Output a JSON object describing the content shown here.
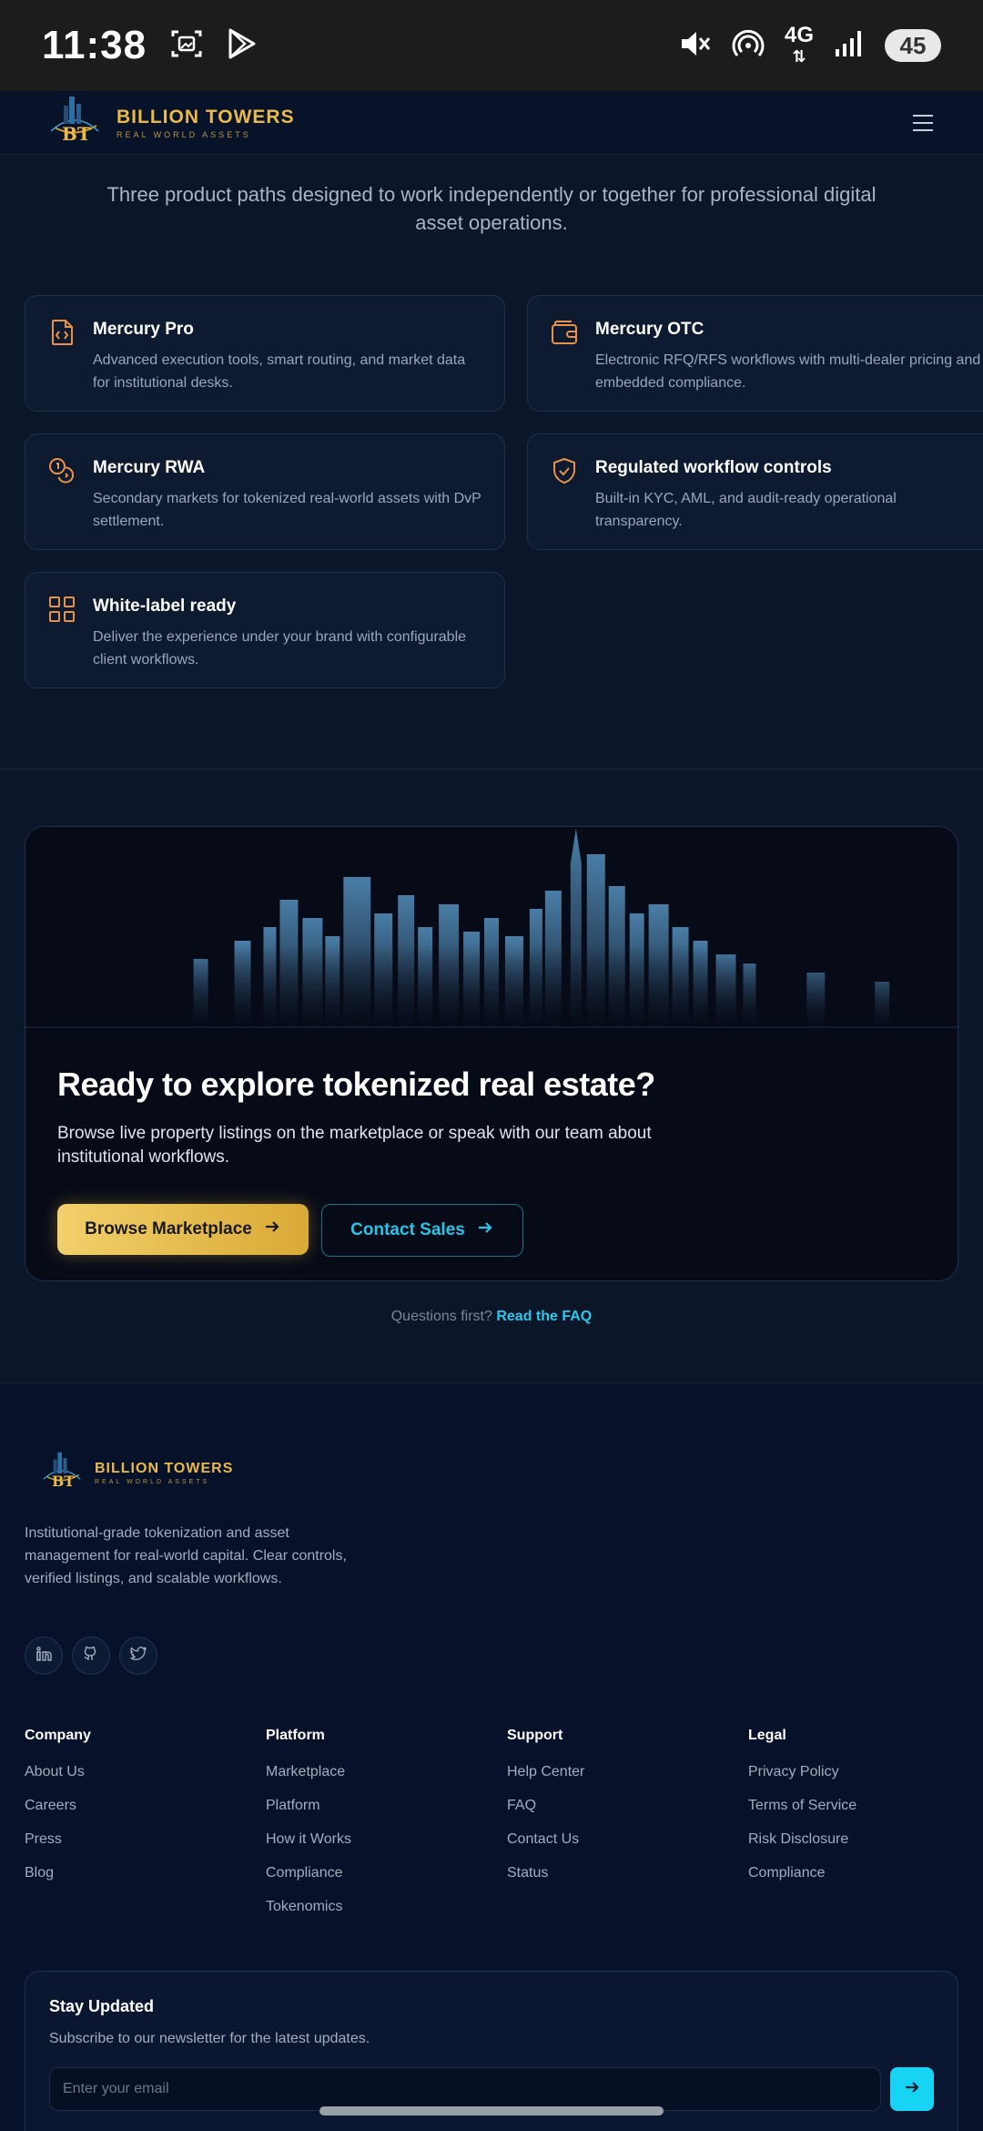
{
  "status_bar": {
    "time": "11:38",
    "network": "4G",
    "battery": "45"
  },
  "nav": {
    "brand_name": "BILLION TOWERS",
    "brand_tagline": "REAL WORLD ASSETS",
    "logo_mark": "BT"
  },
  "products": {
    "subtitle": "Three product paths designed to work independently or together for professional digital asset operations.",
    "cards": [
      {
        "title": "Mercury Pro",
        "description": "Advanced execution tools, smart routing, and market data for institutional desks.",
        "icon": "code-file-icon"
      },
      {
        "title": "Mercury OTC",
        "description": "Electronic RFQ/RFS workflows with multi-dealer pricing and embedded compliance.",
        "icon": "wallet-icon"
      },
      {
        "title": "Mercury RWA",
        "description": "Secondary markets for tokenized real-world assets with DvP settlement.",
        "icon": "coins-icon"
      },
      {
        "title": "Regulated workflow controls",
        "description": "Built-in KYC, AML, and audit-ready operational transparency.",
        "icon": "shield-check-icon"
      },
      {
        "title": "White-label ready",
        "description": "Deliver the experience under your brand with configurable client workflows.",
        "icon": "grid-icon"
      }
    ]
  },
  "cta": {
    "title": "Ready to explore tokenized real estate?",
    "description": "Browse live property listings on the marketplace or speak with our team about institutional workflows.",
    "primary_button": "Browse Marketplace",
    "secondary_button": "Contact Sales",
    "faq_prefix": "Questions first?",
    "faq_link": "Read the FAQ"
  },
  "footer": {
    "description": "Institutional-grade tokenization and asset management for real-world capital. Clear controls, verified listings, and scalable workflows.",
    "socials": [
      "linkedin-icon",
      "github-icon",
      "twitter-icon"
    ],
    "columns": [
      {
        "heading": "Company",
        "links": [
          "About Us",
          "Careers",
          "Press",
          "Blog"
        ]
      },
      {
        "heading": "Platform",
        "links": [
          "Marketplace",
          "Platform",
          "How it Works",
          "Compliance",
          "Tokenomics"
        ]
      },
      {
        "heading": "Support",
        "links": [
          "Help Center",
          "FAQ",
          "Contact Us",
          "Status"
        ]
      },
      {
        "heading": "Legal",
        "links": [
          "Privacy Policy",
          "Terms of Service",
          "Risk Disclosure",
          "Compliance"
        ]
      }
    ],
    "newsletter": {
      "title": "Stay Updated",
      "subtitle": "Subscribe to our newsletter for the latest updates.",
      "placeholder": "Enter your email"
    }
  },
  "colors": {
    "accent_gold": "#e9b94a",
    "accent_cyan": "#18d4f4",
    "icon_orange": "#e8924a",
    "background": "#0b1628"
  }
}
